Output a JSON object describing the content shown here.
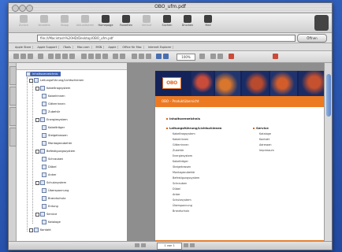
{
  "window": {
    "title": "OBO_ufm.pdf"
  },
  "toolbar": {
    "items": [
      {
        "label": "Zurück",
        "icon": "back-arrow-icon",
        "enabled": false
      },
      {
        "label": "Vorwärts",
        "icon": "forward-arrow-icon",
        "enabled": false
      },
      {
        "label": "Stopp",
        "icon": "stop-icon",
        "enabled": false
      },
      {
        "label": "Aktualisieren",
        "icon": "refresh-icon",
        "enabled": false
      },
      {
        "label": "Homepage",
        "icon": "home-icon",
        "enabled": true
      },
      {
        "label": "Favoriten",
        "icon": "favorites-icon",
        "enabled": true
      },
      {
        "label": "Verlauf",
        "icon": "history-icon",
        "enabled": false
      },
      {
        "label": "Suchen",
        "icon": "search-icon",
        "enabled": true
      },
      {
        "label": "Drucken",
        "icon": "print-icon",
        "enabled": true
      },
      {
        "label": "Mail",
        "icon": "mail-icon",
        "enabled": true
      }
    ]
  },
  "address": {
    "url": "file:///Macintosh%20HD/Desktop/OBO_ufm.pdf",
    "go_label": "Öffnen"
  },
  "bookmarks_bar": [
    "Apple Store",
    "Apple Support",
    "iTools",
    "Mac.com",
    "MSN",
    "Apple",
    "Office für Mac",
    "Internet Explorer"
  ],
  "pdf_toolbar": {
    "zoom": "100%"
  },
  "tree": {
    "root": "Inhaltsverzeichnis",
    "items": [
      {
        "label": "Leitungsführung/Lichtschienen",
        "level": 1
      },
      {
        "label": "Kabeltragsystem",
        "level": 2
      },
      {
        "label": "Kabelrinnen",
        "level": 3
      },
      {
        "label": "Gitterrinnen",
        "level": 3
      },
      {
        "label": "Zubehör",
        "level": 3
      },
      {
        "label": "Energiesystem",
        "level": 2
      },
      {
        "label": "Kabelträger",
        "level": 3
      },
      {
        "label": "Steigetrassen",
        "level": 3
      },
      {
        "label": "Montagezubehör",
        "level": 3
      },
      {
        "label": "Befestigungssystem",
        "level": 2
      },
      {
        "label": "Schrauben",
        "level": 3
      },
      {
        "label": "Dübel",
        "level": 3
      },
      {
        "label": "Anker",
        "level": 3
      },
      {
        "label": "Schutzsystem",
        "level": 2
      },
      {
        "label": "Überspannung",
        "level": 3
      },
      {
        "label": "Brandschutz",
        "level": 3
      },
      {
        "label": "Erdung",
        "level": 3
      },
      {
        "label": "Service",
        "level": 2
      },
      {
        "label": "Kataloge",
        "level": 3
      },
      {
        "label": "Kontakt",
        "level": 1
      }
    ]
  },
  "pdf_page": {
    "logo": "OBO",
    "subtitle": "OBO – Produktübersicht",
    "section_title": "Inhaltsverzeichnis",
    "left_heading": "Leitungsführung/Lichtschienen",
    "left_items": [
      "Kabeltragsystem",
      "Kabelrinnen",
      "Gitterrinnen",
      "Zubehör",
      "Energiesystem",
      "Kabelträger",
      "Steigetrassen",
      "Montagezubehör",
      "Befestigungssystem",
      "Schrauben",
      "Dübel",
      "Anker",
      "Schutzsystem",
      "Überspannung",
      "Brandschutz"
    ],
    "right_heading": "Service",
    "right_items": [
      "Kataloge",
      "Kontakt",
      "Adressen",
      "Impressum"
    ]
  },
  "statusbar": {
    "page": "1 von 1"
  },
  "colors": {
    "accent_orange": "#ec7a23",
    "banner_navy": "#13235a",
    "selection": "#3e63b3"
  }
}
